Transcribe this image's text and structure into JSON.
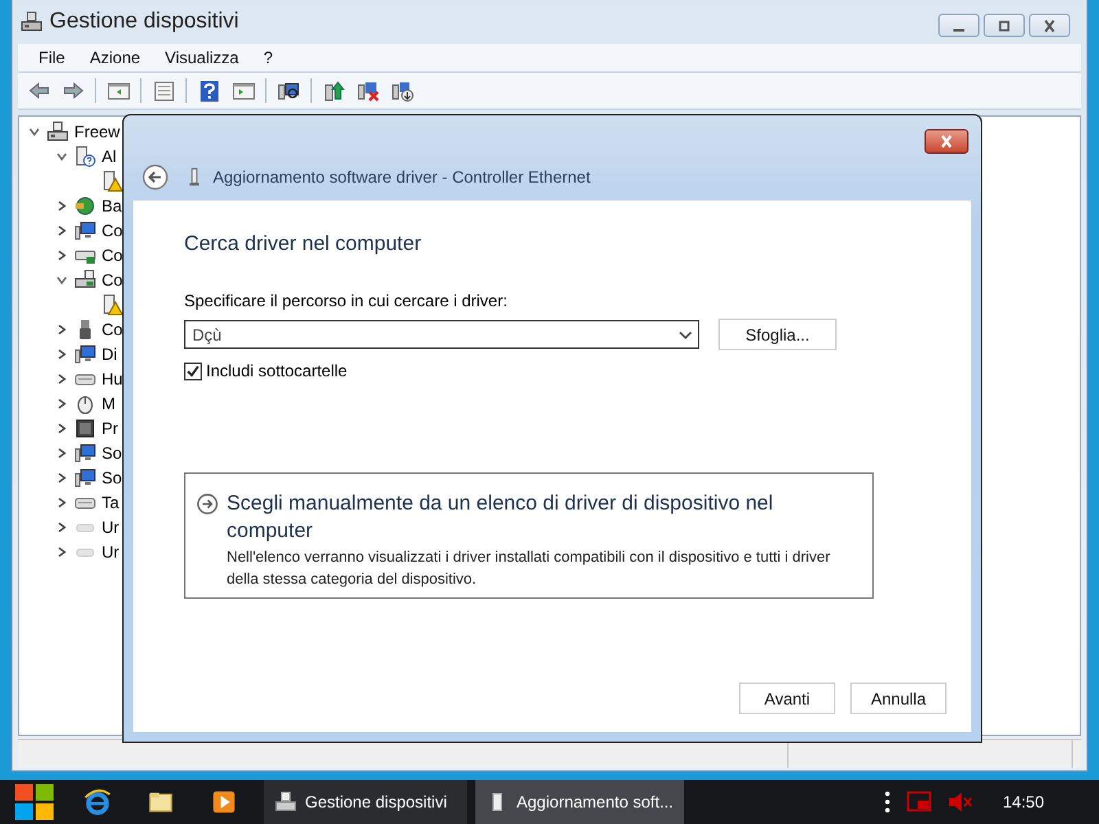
{
  "window": {
    "title": "Gestione dispositivi"
  },
  "menu": [
    "File",
    "Azione",
    "Visualizza",
    "?"
  ],
  "tree": [
    {
      "label": "Freew",
      "kind": "computer",
      "expanded": true,
      "children": [
        {
          "label": "Al",
          "kind": "unknown",
          "expanded": true,
          "children": [
            {
              "kind": "warning"
            }
          ]
        },
        {
          "label": "Ba",
          "kind": "battery",
          "expanded": false
        },
        {
          "label": "Co",
          "kind": "monitor",
          "expanded": false
        },
        {
          "label": "Co",
          "kind": "drive",
          "expanded": false
        },
        {
          "label": "Co",
          "kind": "network",
          "expanded": true,
          "children": [
            {
              "kind": "warning"
            }
          ]
        },
        {
          "label": "Co",
          "kind": "usb",
          "expanded": false
        },
        {
          "label": "Di",
          "kind": "monitor",
          "expanded": false
        },
        {
          "label": "Hu",
          "kind": "keyboard",
          "expanded": false
        },
        {
          "label": "M",
          "kind": "mouse",
          "expanded": false
        },
        {
          "label": "Pr",
          "kind": "chip",
          "expanded": false
        },
        {
          "label": "So",
          "kind": "monitor",
          "expanded": false
        },
        {
          "label": "So",
          "kind": "monitor",
          "expanded": false
        },
        {
          "label": "Ta",
          "kind": "keyboard",
          "expanded": false
        },
        {
          "label": "Ur",
          "kind": "faded",
          "expanded": false
        },
        {
          "label": "Ur",
          "kind": "faded",
          "expanded": false
        }
      ]
    }
  ],
  "dialog": {
    "title": "Aggiornamento software driver - Controller Ethernet",
    "heading": "Cerca driver nel computer",
    "path_label": "Specificare il percorso in cui cercare i driver:",
    "path_value": "Dçù",
    "browse_button": "Sfoglia...",
    "include_subfolders": {
      "label": "Includi sottocartelle",
      "checked": true
    },
    "command_link": {
      "title": "Scegli manualmente da un elenco di driver di dispositivo nel computer",
      "description": "Nell'elenco verranno visualizzati i driver installati compatibili con il dispositivo e tutti i driver della stessa categoria del dispositivo."
    },
    "buttons": [
      "Avanti",
      "Annulla"
    ]
  },
  "taskbar": {
    "tasks": [
      {
        "label": "Gestione dispositivi",
        "selected": false
      },
      {
        "label": "Aggiornamento soft...",
        "selected": true
      }
    ],
    "clock": "14:50"
  }
}
